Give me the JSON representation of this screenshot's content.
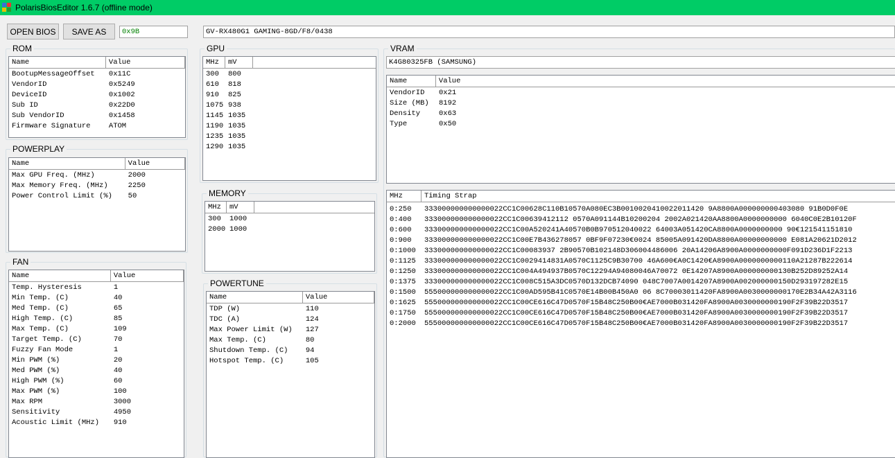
{
  "window": {
    "title": "PolarisBiosEditor 1.6.7 (offline mode)"
  },
  "toolbar": {
    "open_label": "OPEN BIOS",
    "save_label": "SAVE AS",
    "checksum_value": "0x9B",
    "bios_name": "GV-RX480G1 GAMING-8GD/F8/0438"
  },
  "colors": {
    "titlebar": "#00cc66",
    "checksum_text": "#008000"
  },
  "rom": {
    "title": "ROM",
    "headers": [
      "Name",
      "Value"
    ],
    "rows": [
      [
        "BootupMessageOffset",
        "0x11C"
      ],
      [
        "VendorID",
        "0x5249"
      ],
      [
        "DeviceID",
        "0x1002"
      ],
      [
        "Sub ID",
        "0x22D0"
      ],
      [
        "Sub VendorID",
        "0x1458"
      ],
      [
        "Firmware Signature",
        "ATOM"
      ]
    ]
  },
  "powerplay": {
    "title": "POWERPLAY",
    "headers": [
      "Name",
      "Value"
    ],
    "rows": [
      [
        "Max GPU Freq. (MHz)",
        "2000"
      ],
      [
        "Max Memory Freq. (MHz)",
        "2250"
      ],
      [
        "Power Control Limit (%)",
        "50"
      ]
    ]
  },
  "fan": {
    "title": "FAN",
    "headers": [
      "Name",
      "Value"
    ],
    "rows": [
      [
        "Temp. Hysteresis",
        "1"
      ],
      [
        "Min Temp. (C)",
        "40"
      ],
      [
        "Med Temp. (C)",
        "65"
      ],
      [
        "High Temp. (C)",
        "85"
      ],
      [
        "Max Temp. (C)",
        "109"
      ],
      [
        "Target Temp. (C)",
        "70"
      ],
      [
        "Fuzzy Fan Mode",
        "1"
      ],
      [
        "Min PWM (%)",
        "20"
      ],
      [
        "Med PWM (%)",
        "40"
      ],
      [
        "High PWM (%)",
        "60"
      ],
      [
        "Max PWM (%)",
        "100"
      ],
      [
        "Max RPM",
        "3000"
      ],
      [
        "Sensitivity",
        "4950"
      ],
      [
        "Acoustic Limit (MHz)",
        "910"
      ]
    ]
  },
  "gpu": {
    "title": "GPU",
    "headers": [
      "MHz",
      "mV"
    ],
    "rows": [
      [
        "300",
        "800"
      ],
      [
        "610",
        "818"
      ],
      [
        "910",
        "825"
      ],
      [
        "1075",
        "938"
      ],
      [
        "1145",
        "1035"
      ],
      [
        "1190",
        "1035"
      ],
      [
        "1235",
        "1035"
      ],
      [
        "1290",
        "1035"
      ]
    ]
  },
  "memory": {
    "title": "MEMORY",
    "headers": [
      "MHz",
      "mV"
    ],
    "rows": [
      [
        "300",
        "1000"
      ],
      [
        "2000",
        "1000"
      ]
    ]
  },
  "powertune": {
    "title": "POWERTUNE",
    "headers": [
      "Name",
      "Value"
    ],
    "rows": [
      [
        "TDP (W)",
        "110"
      ],
      [
        "TDC (A)",
        "124"
      ],
      [
        "Max Power Limit (W)",
        "127"
      ],
      [
        "Max Temp. (C)",
        "80"
      ],
      [
        "Shutdown Temp. (C)",
        "94"
      ],
      [
        "Hotspot Temp. (C)",
        "105"
      ]
    ]
  },
  "vram": {
    "title": "VRAM",
    "module": "K4G80325FB (SAMSUNG)",
    "headers": [
      "Name",
      "Value"
    ],
    "rows": [
      [
        "VendorID",
        "0x21"
      ],
      [
        "Size (MB)",
        "8192"
      ],
      [
        "Density",
        "0x63"
      ],
      [
        "Type",
        "0x50"
      ]
    ],
    "timing_headers": [
      "MHz",
      "Timing Strap"
    ],
    "timings": [
      [
        "0:250",
        "333000000000000022CC1C00628C110B10570A080EC3B0010020410022011420 9A8800A000000000403080 91B0D0F0E"
      ],
      [
        "0:400",
        "333000000000000022CC1C00639412112 0570A091144B10200204 2002A021420AA8800A0000000000 6040C0E2B10120F"
      ],
      [
        "0:600",
        "333000000000000022CC1C00A520241A40570B0B970512040022 64003A051420CA8800A0000000000 90€121541151810"
      ],
      [
        "0:900",
        "333000000000000022CC1C00E7B436278057 0BF9F07230€0024 85005A091420DA8800A00000000000 E081A20621D2012"
      ],
      [
        "0:1000",
        "333000000000000022CC1C00083937 2B90570B102148D306004486006 20A14206A8900A0000000000F091D236D1F2213"
      ],
      [
        "0:1125",
        "333000000000000022CC1C0029414831A0570C1125C9B30700 46A600€A0C1420€A8900A0000000000110A21287B222614"
      ],
      [
        "0:1250",
        "333000000000000022CC1C004A494937B0570C12294A94080046A70072 0E14207A8900A000000000130B252D89252A14"
      ],
      [
        "0:1375",
        "333000000000000022CC1C008C515A3DC0570D132DCB74090 048C7007A0014207A8900A002000000150D293197282E15"
      ],
      [
        "0:1500",
        "555000000000000022CC1C00AD595B41C0570E14B00B450A0 06 8C70003011420FA8900A0030000000170E2B34A42A3116"
      ],
      [
        "0:1625",
        "555000000000000022CC1C00CE616C47D0570F15B48C250B00€AE7000B031420FA8900A0030000000190F2F39B22D3517"
      ],
      [
        "0:1750",
        "555000000000000022CC1C00CE616C47D0570F15B48C250B00€AE7000B031420FA8900A0030000000190F2F39B22D3517"
      ],
      [
        "0:2000",
        "555000000000000022CC1C00CE616C47D0570F15B48C250B00€AE7000B031420FA8900A0030000000190F2F39B22D3517"
      ]
    ]
  }
}
